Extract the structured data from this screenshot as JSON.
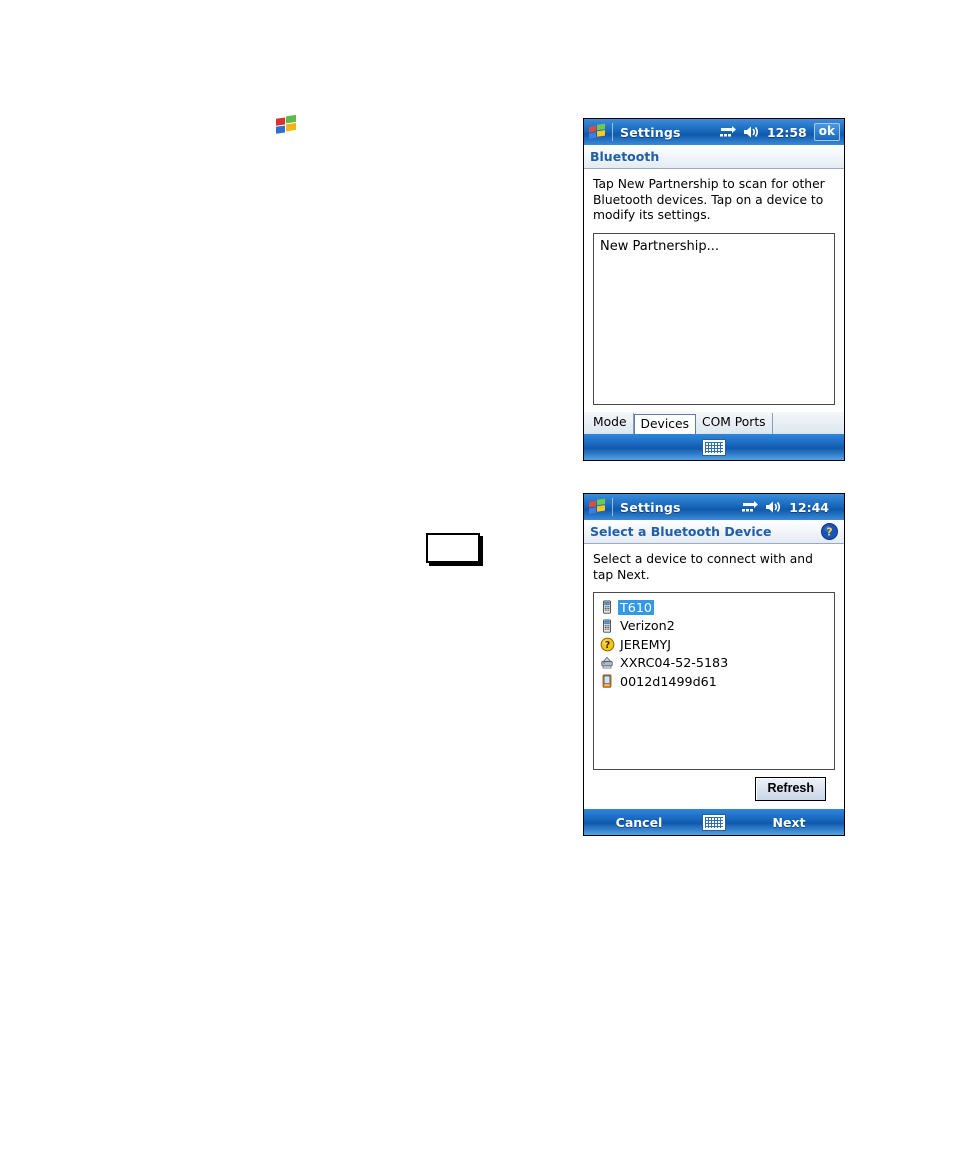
{
  "page": {
    "start_flag_icon": "windows-start-flag-icon",
    "callout_box_note": ""
  },
  "window_bluetooth": {
    "titlebar": {
      "start_icon": "windows-start-flag-icon",
      "title": "Settings",
      "connectivity_icon": "connectivity-icon",
      "volume_icon": "speaker-icon",
      "time": "12:58",
      "ok_label": "ok"
    },
    "header": {
      "title": "Bluetooth"
    },
    "instruction": "Tap New Partnership to scan for other Bluetooth devices. Tap on a device to modify its settings.",
    "list": {
      "items": [
        {
          "label": "New Partnership..."
        }
      ]
    },
    "tabs": [
      {
        "label": "Mode",
        "active": false
      },
      {
        "label": "Devices",
        "active": true
      },
      {
        "label": "COM Ports",
        "active": false
      }
    ],
    "softbar": {
      "left_label": "",
      "keyboard_icon": "keyboard-icon",
      "right_label": ""
    }
  },
  "window_select_device": {
    "titlebar": {
      "start_icon": "windows-start-flag-icon",
      "title": "Settings",
      "connectivity_icon": "connectivity-icon",
      "volume_icon": "speaker-icon",
      "time": "12:44"
    },
    "header": {
      "title": "Select a Bluetooth Device",
      "help_icon": "help-question-icon"
    },
    "instruction": "Select a device to connect with and tap Next.",
    "device_list": [
      {
        "label": "T610",
        "icon": "mobile-phone-icon",
        "selected": true
      },
      {
        "label": "Verizon2",
        "icon": "mobile-phone-icon",
        "selected": false
      },
      {
        "label": "JEREMYJ",
        "icon": "unknown-device-icon",
        "selected": false
      },
      {
        "label": "XXRC04-52-5183",
        "icon": "printer-icon",
        "selected": false
      },
      {
        "label": "0012d1499d61",
        "icon": "pda-device-icon",
        "selected": false
      }
    ],
    "refresh_label": "Refresh",
    "softbar": {
      "left_label": "Cancel",
      "keyboard_icon": "keyboard-icon",
      "right_label": "Next"
    }
  },
  "colors": {
    "titlebar_blue": "#1c6cc0",
    "header_link_blue": "#1e5fa8",
    "selection_blue": "#3399e5",
    "softbar_blue": "#1a6bc2"
  }
}
